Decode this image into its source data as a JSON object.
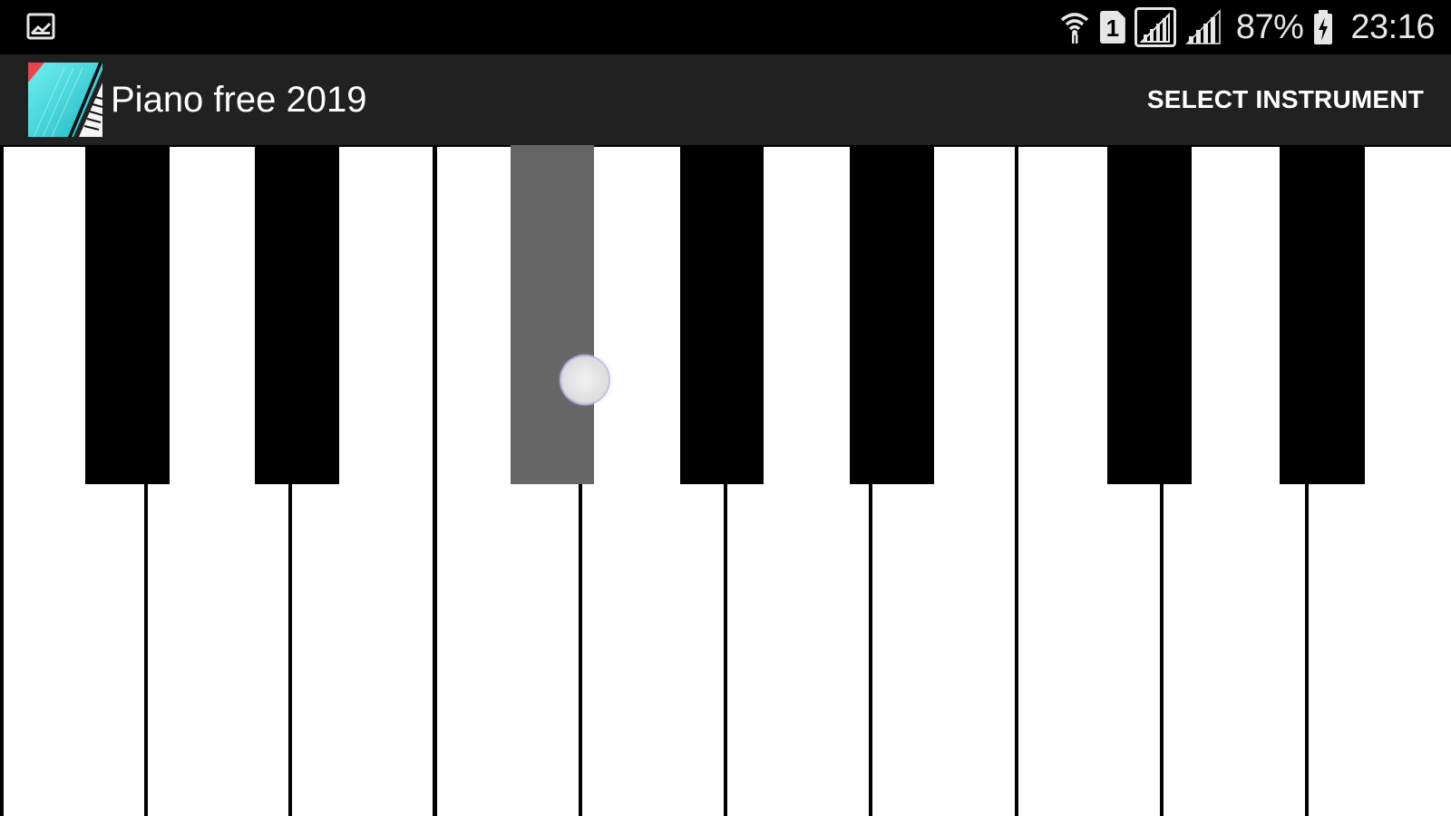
{
  "status_bar": {
    "left_icon": "gallery-icon",
    "icons": [
      "wifi-icon",
      "sim-1-icon",
      "signal-icon",
      "signal-icon"
    ],
    "sim_label": "1",
    "battery_percent": "87%",
    "battery_icon": "battery-charging-icon",
    "time": "23:16"
  },
  "app_bar": {
    "app_icon": "piano-app-icon",
    "title": "Piano free 2019",
    "action_label": "SELECT INSTRUMENT"
  },
  "keyboard": {
    "white_key_count": 10,
    "black_key_count": 7,
    "pressed_black_key_index": 2,
    "colors": {
      "white_key": "#ffffff",
      "black_key": "#000000",
      "pressed_key": "#666666",
      "app_bar": "#212121",
      "status_bar": "#000000"
    }
  }
}
